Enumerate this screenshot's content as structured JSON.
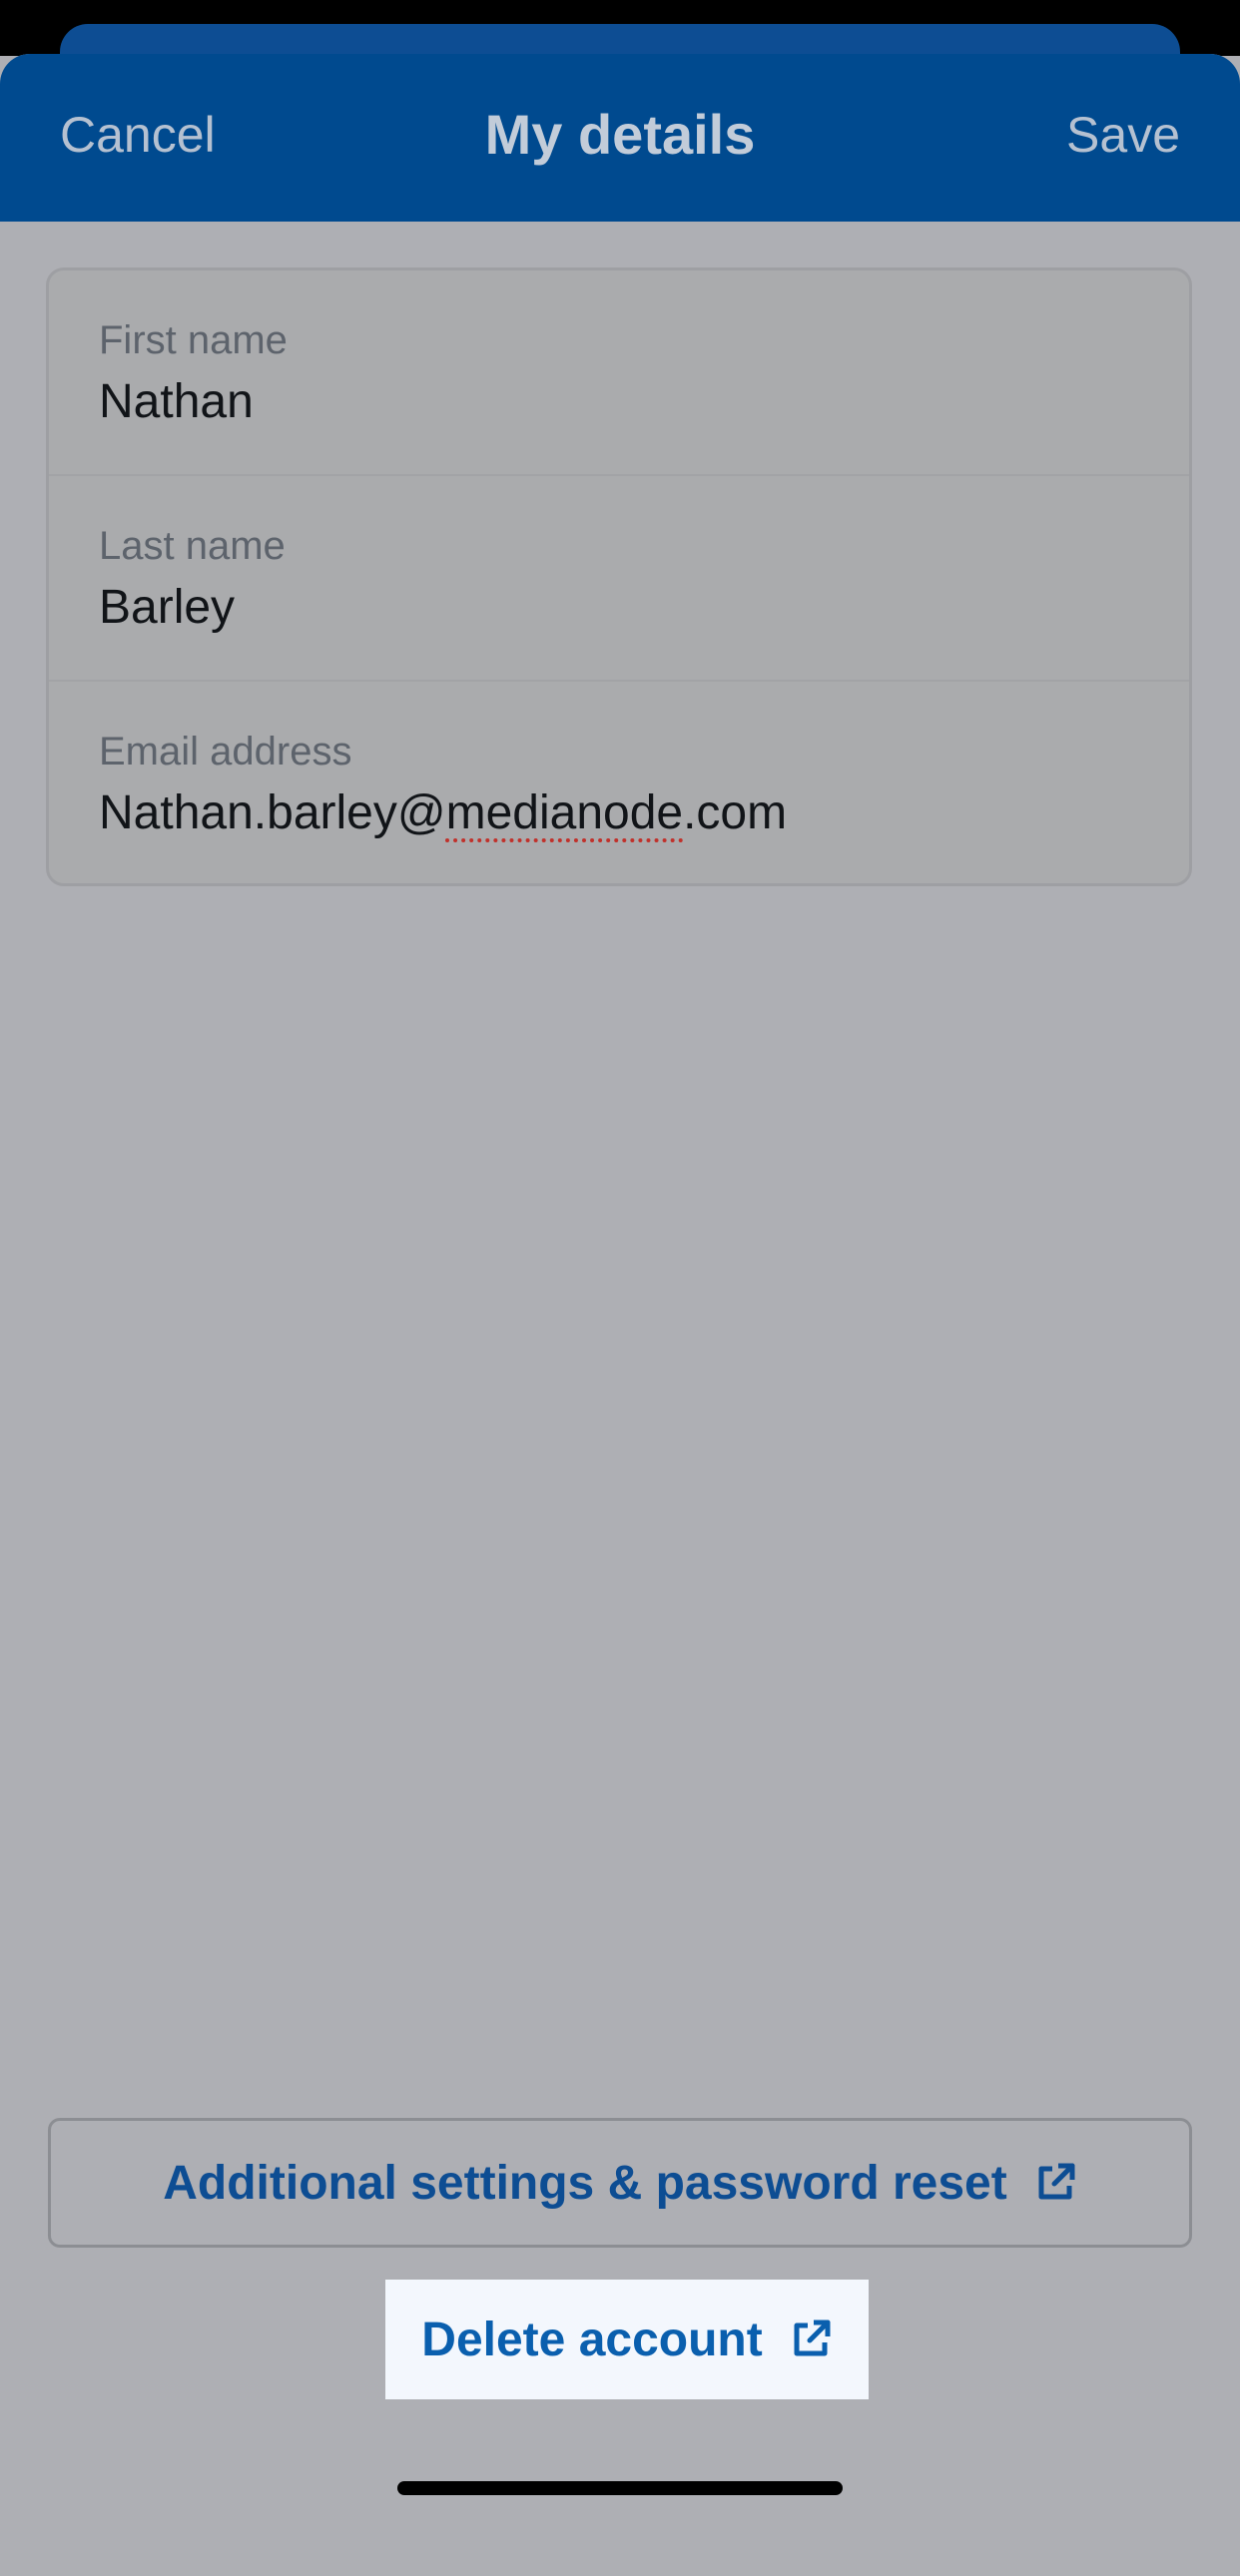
{
  "header": {
    "cancel_label": "Cancel",
    "title": "My details",
    "save_label": "Save"
  },
  "form": {
    "first_name": {
      "label": "First name",
      "value": "Nathan"
    },
    "last_name": {
      "label": "Last name",
      "value": "Barley"
    },
    "email": {
      "label": "Email address",
      "value_prefix": "Nathan.barley@",
      "value_flagged": "medianode",
      "value_suffix": ".com"
    }
  },
  "actions": {
    "additional_settings_label": "Additional settings & password reset",
    "delete_account_label": "Delete account",
    "icon": "external-link-icon"
  },
  "colors": {
    "header_bg": "#004a8f",
    "overlay_bg": "#aeafb4",
    "link_blue": "#0d4d93",
    "delete_highlight_bg": "#f3f7fd"
  }
}
